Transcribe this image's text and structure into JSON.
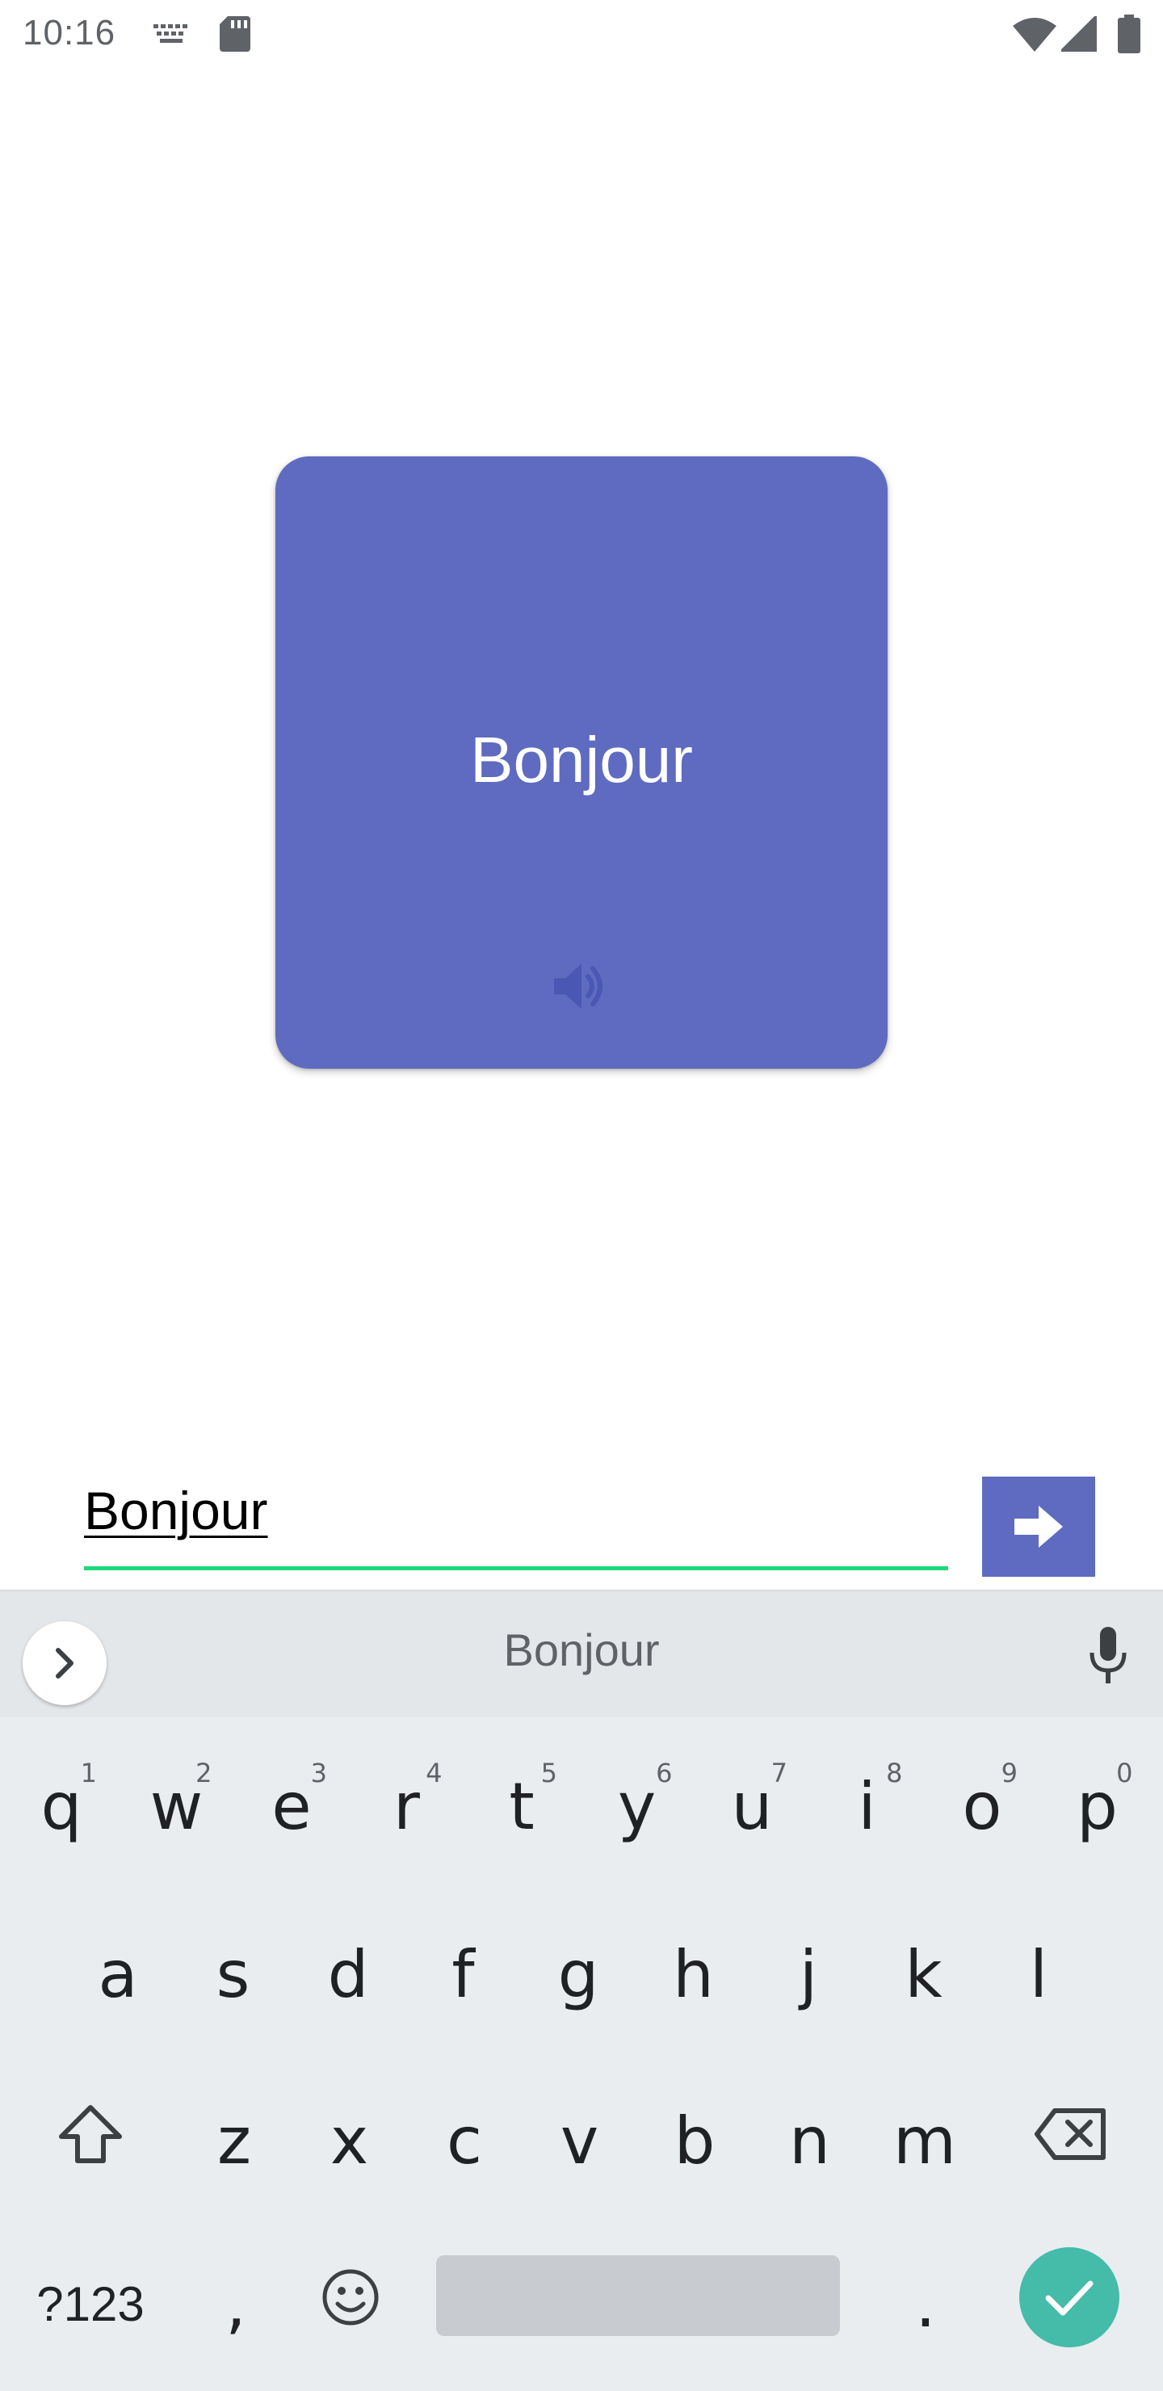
{
  "status_bar": {
    "time": "10:16",
    "icons": [
      "keyboard-icon",
      "sd-card-icon",
      "wifi-icon",
      "cell-signal-icon",
      "battery-icon"
    ]
  },
  "card": {
    "word": "Bonjour",
    "color": "#5e6bc0",
    "audio_icon": "speaker-icon"
  },
  "answer": {
    "value": "Bonjour",
    "underline_color": "#1fd87d",
    "submit_icon": "arrow-right-icon"
  },
  "keyboard": {
    "suggestion": "Bonjour",
    "row1": [
      {
        "key": "q",
        "hint": "1"
      },
      {
        "key": "w",
        "hint": "2"
      },
      {
        "key": "e",
        "hint": "3"
      },
      {
        "key": "r",
        "hint": "4"
      },
      {
        "key": "t",
        "hint": "5"
      },
      {
        "key": "y",
        "hint": "6"
      },
      {
        "key": "u",
        "hint": "7"
      },
      {
        "key": "i",
        "hint": "8"
      },
      {
        "key": "o",
        "hint": "9"
      },
      {
        "key": "p",
        "hint": "0"
      }
    ],
    "row2": [
      "a",
      "s",
      "d",
      "f",
      "g",
      "h",
      "j",
      "k",
      "l"
    ],
    "row3": [
      "z",
      "x",
      "c",
      "v",
      "b",
      "n",
      "m"
    ],
    "symbols_label": "?123",
    "comma": ",",
    "period": ".",
    "enter_color": "#45bba9"
  }
}
